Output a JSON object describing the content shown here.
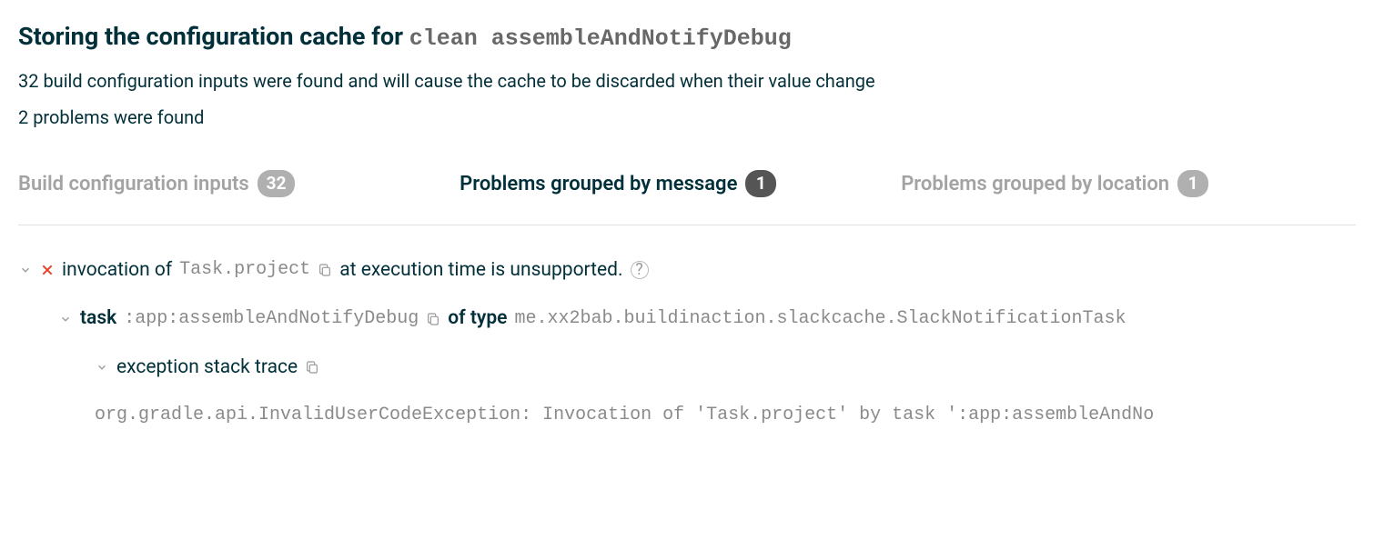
{
  "header": {
    "title_prefix": "Storing the configuration cache for ",
    "task_name": "clean assembleAndNotifyDebug",
    "summary_inputs": "32 build configuration inputs were found and will cause the cache to be discarded when their value change",
    "summary_problems": "2 problems were found"
  },
  "tabs": {
    "inputs": {
      "label": "Build configuration inputs",
      "count": "32",
      "active": false
    },
    "by_message": {
      "label": "Problems grouped by message",
      "count": "1",
      "active": true
    },
    "by_location": {
      "label": "Problems grouped by location",
      "count": "1",
      "active": false
    }
  },
  "problem": {
    "prefix": "invocation of ",
    "code": "Task.project",
    "suffix": " at execution time is unsupported.",
    "task_label": "task",
    "task_path": ":app:assembleAndNotifyDebug",
    "of_type_label": " of type ",
    "task_type": "me.xx2bab.buildinaction.slackcache.SlackNotificationTask",
    "stack_label": "exception stack trace",
    "stack_text": "org.gradle.api.InvalidUserCodeException: Invocation of 'Task.project' by task ':app:assembleAndNo"
  }
}
